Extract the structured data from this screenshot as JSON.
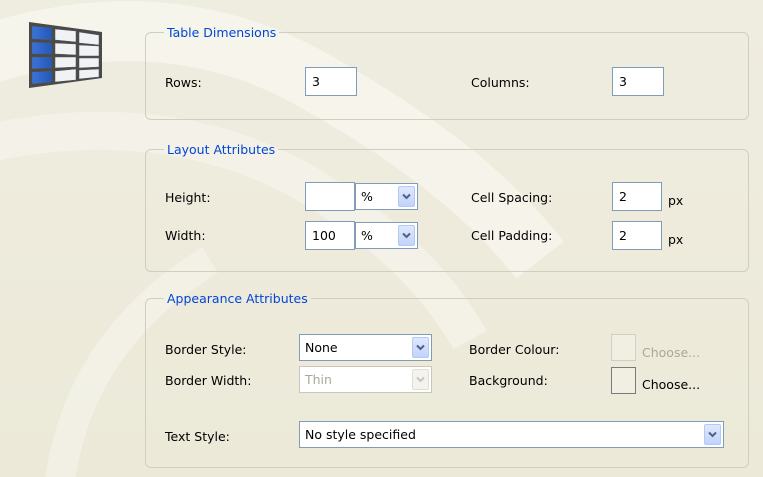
{
  "table_dimensions": {
    "legend": "Table Dimensions",
    "rows_label": "Rows:",
    "rows_value": "3",
    "columns_label": "Columns:",
    "columns_value": "3"
  },
  "layout_attributes": {
    "legend": "Layout Attributes",
    "height_label": "Height:",
    "height_value": "",
    "height_unit": "%",
    "width_label": "Width:",
    "width_value": "100",
    "width_unit": "%",
    "cell_spacing_label": "Cell Spacing:",
    "cell_spacing_value": "2",
    "cell_spacing_unit": "px",
    "cell_padding_label": "Cell Padding:",
    "cell_padding_value": "2",
    "cell_padding_unit": "px"
  },
  "appearance_attributes": {
    "legend": "Appearance Attributes",
    "border_style_label": "Border Style:",
    "border_style_value": "None",
    "border_width_label": "Border Width:",
    "border_width_value": "Thin",
    "border_colour_label": "Border Colour:",
    "border_colour_choose": "Choose...",
    "background_label": "Background:",
    "background_choose": "Choose...",
    "text_style_label": "Text Style:",
    "text_style_value": "No style specified"
  },
  "icons": {
    "header": "table-icon",
    "dropdown": "chevron-down-icon"
  },
  "colors": {
    "legend_text": "#0046d5",
    "dialog_bg": "#ece9d8",
    "input_border": "#7f9db9",
    "disabled_text": "#aca899"
  }
}
